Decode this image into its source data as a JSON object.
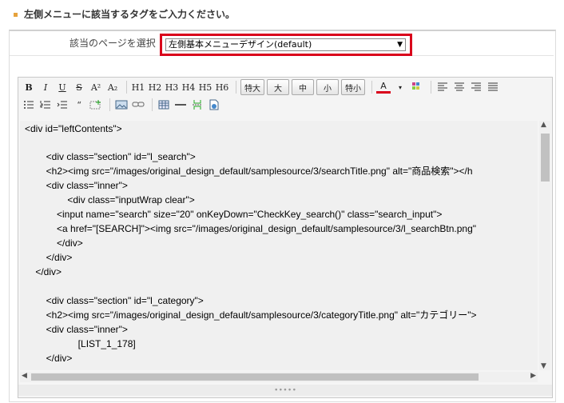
{
  "heading": "左側メニューに該当するタグをご入力ください。",
  "select": {
    "label": "該当のページを選択",
    "value": "左側基本メニューデザイン(default)"
  },
  "toolbar": {
    "row1": [
      "B",
      "I",
      "U",
      "S",
      "A²",
      "A₂",
      "H1",
      "H2",
      "H3",
      "H4",
      "H5",
      "H6",
      "特大",
      "大",
      "中",
      "小",
      "特小",
      "A"
    ],
    "row2_quote": "“"
  },
  "code_lines": [
    "<div id=\"leftContents\">",
    "",
    "        <div class=\"section\" id=\"l_search\">",
    "        <h2><img src=\"/images/original_design_default/samplesource/3/searchTitle.png\" alt=\"商品検索\"></h",
    "        <div class=\"inner\">",
    "                <div class=\"inputWrap clear\">",
    "            <input name=\"search\" size=\"20\" onKeyDown=\"CheckKey_search()\" class=\"search_input\">",
    "            <a href=\"[SEARCH]\"><img src=\"/images/original_design_default/samplesource/3/l_searchBtn.png\"",
    "            </div>",
    "        </div>",
    "    </div>",
    "",
    "        <div class=\"section\" id=\"l_category\">",
    "        <h2><img src=\"/images/original_design_default/samplesource/3/categoryTitle.png\" alt=\"カテゴリー\">",
    "        <div class=\"inner\">",
    "                    [LIST_1_178]",
    "        </div>"
  ],
  "colors": {
    "accent": "#e6a23c",
    "highlight": "#d9001b"
  }
}
